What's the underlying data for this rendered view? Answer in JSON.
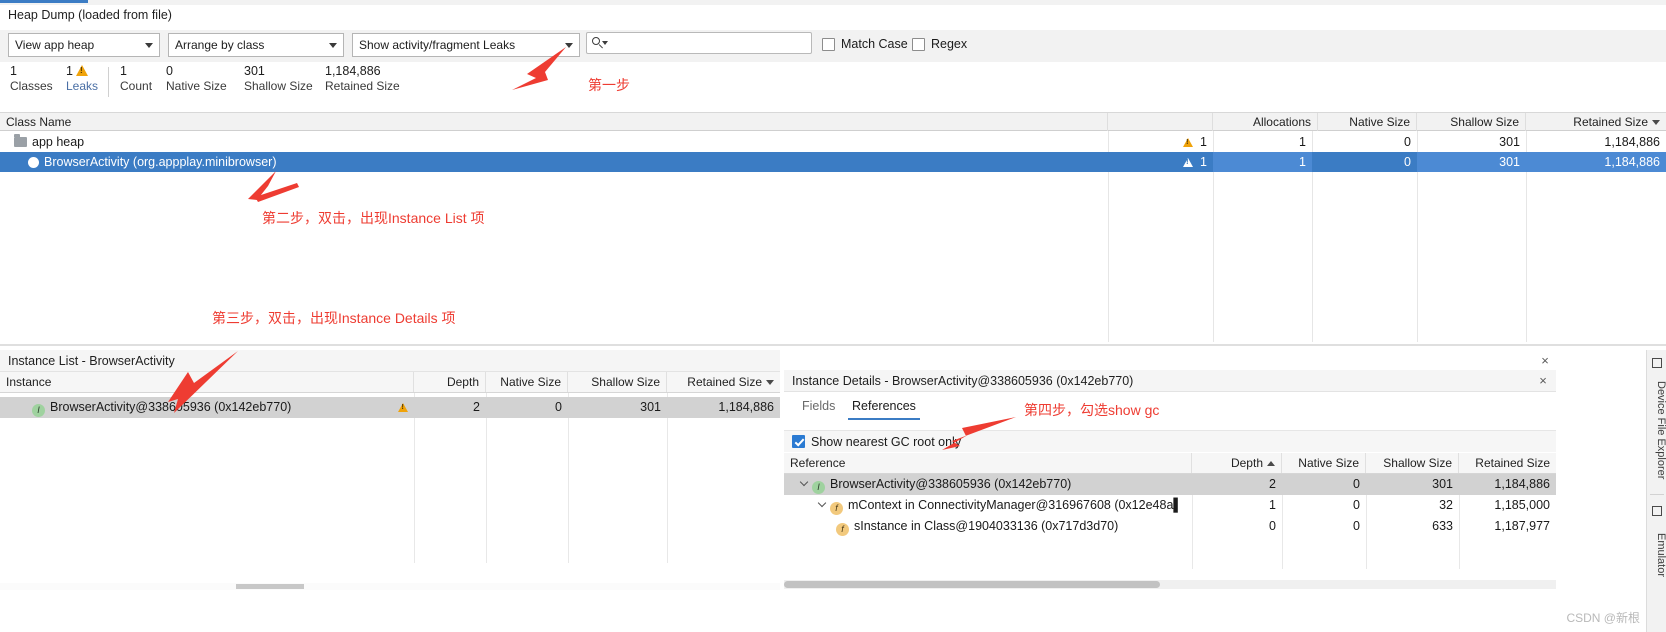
{
  "window": {
    "heap_title": "Heap Dump (loaded from file)"
  },
  "toolbar": {
    "heap_select": "View app heap",
    "arrange_select": "Arrange by class",
    "show_select": "Show activity/fragment Leaks",
    "search_value": "",
    "search_placeholder": "",
    "match_case_label": "Match Case",
    "regex_label": "Regex",
    "match_case_checked": false,
    "regex_checked": false
  },
  "stats": [
    {
      "num": "1",
      "caption": "Classes",
      "warn": false
    },
    {
      "num": "1",
      "caption": "Leaks",
      "warn": true
    },
    {
      "num": "1",
      "caption": "Count",
      "warn": false
    },
    {
      "num": "0",
      "caption": "Native Size",
      "warn": false
    },
    {
      "num": "301",
      "caption": "Shallow Size",
      "warn": false
    },
    {
      "num": "1,184,886",
      "caption": "Retained Size",
      "warn": false
    }
  ],
  "class_table": {
    "headers": {
      "class_name": "Class Name",
      "allocations": "Allocations",
      "native_size": "Native Size",
      "shallow_size": "Shallow Size",
      "retained_size": "Retained Size"
    },
    "sorted_by": "Retained Size",
    "rows": [
      {
        "name": "app heap",
        "icon": "folder-icon",
        "leaks": "1",
        "allocations": "1",
        "native_size": "0",
        "shallow_size": "301",
        "retained_size": "1,184,886",
        "selected": false
      },
      {
        "name": "BrowserActivity (org.appplay.minibrowser)",
        "icon": "circle-icon",
        "leaks": "1",
        "allocations": "1",
        "native_size": "0",
        "shallow_size": "301",
        "retained_size": "1,184,886",
        "selected": true
      }
    ]
  },
  "instance_list": {
    "title": "Instance List - BrowserActivity",
    "close_label": "×",
    "headers": {
      "instance": "Instance",
      "depth": "Depth",
      "native_size": "Native Size",
      "shallow_size": "Shallow Size",
      "retained_size": "Retained Size"
    },
    "sorted_by": "Retained Size",
    "rows": [
      {
        "instance": "BrowserActivity@338605936 (0x142eb770)",
        "badge": "I",
        "warn": true,
        "depth": "2",
        "native_size": "0",
        "shallow_size": "301",
        "retained_size": "1,184,886"
      }
    ]
  },
  "instance_details": {
    "title": "Instance Details - BrowserActivity@338605936 (0x142eb770)",
    "close_label": "×",
    "tabs": [
      {
        "label": "Fields",
        "active": false
      },
      {
        "label": "References",
        "active": true
      }
    ],
    "gc_checkbox_label": "Show nearest GC root only",
    "gc_checkbox_checked": true,
    "headers": {
      "reference": "Reference",
      "depth": "Depth",
      "native_size": "Native Size",
      "shallow_size": "Shallow Size",
      "retained_size": "Retained Size"
    },
    "sorted_by": "Depth",
    "rows": [
      {
        "reference": "BrowserActivity@338605936 (0x142eb770)",
        "badge": "I",
        "badge_type": "i",
        "indent": 0,
        "expanded": true,
        "highlighted": true,
        "depth": "2",
        "native_size": "0",
        "shallow_size": "301",
        "retained_size": "1,184,886"
      },
      {
        "reference": "mContext in ConnectivityManager@316967608 (0x12e48a▌",
        "badge": "f",
        "badge_type": "f",
        "indent": 1,
        "expanded": true,
        "highlighted": false,
        "depth": "1",
        "native_size": "0",
        "shallow_size": "32",
        "retained_size": "1,185,000"
      },
      {
        "reference": "sInstance in Class@1904033136 (0x717d3d70)",
        "badge": "f",
        "badge_type": "f",
        "indent": 2,
        "expanded": false,
        "highlighted": false,
        "depth": "0",
        "native_size": "0",
        "shallow_size": "633",
        "retained_size": "1,187,977"
      }
    ]
  },
  "dock": {
    "items": [
      "Device File Explorer",
      "Emulator"
    ]
  },
  "annotations": [
    {
      "text": "第一步"
    },
    {
      "text": "第二步，双击，出现Instance List 项"
    },
    {
      "text": "第三步，双击，出现Instance Details 项"
    },
    {
      "text": "第四步，勾选show gc"
    }
  ],
  "watermark": "CSDN @新根",
  "colors": {
    "selection_blue": "#3b7cc4",
    "annotation_red": "#ee3c32",
    "warning_orange": "#f0a30a",
    "accent_tab": "#3b7cc4"
  }
}
